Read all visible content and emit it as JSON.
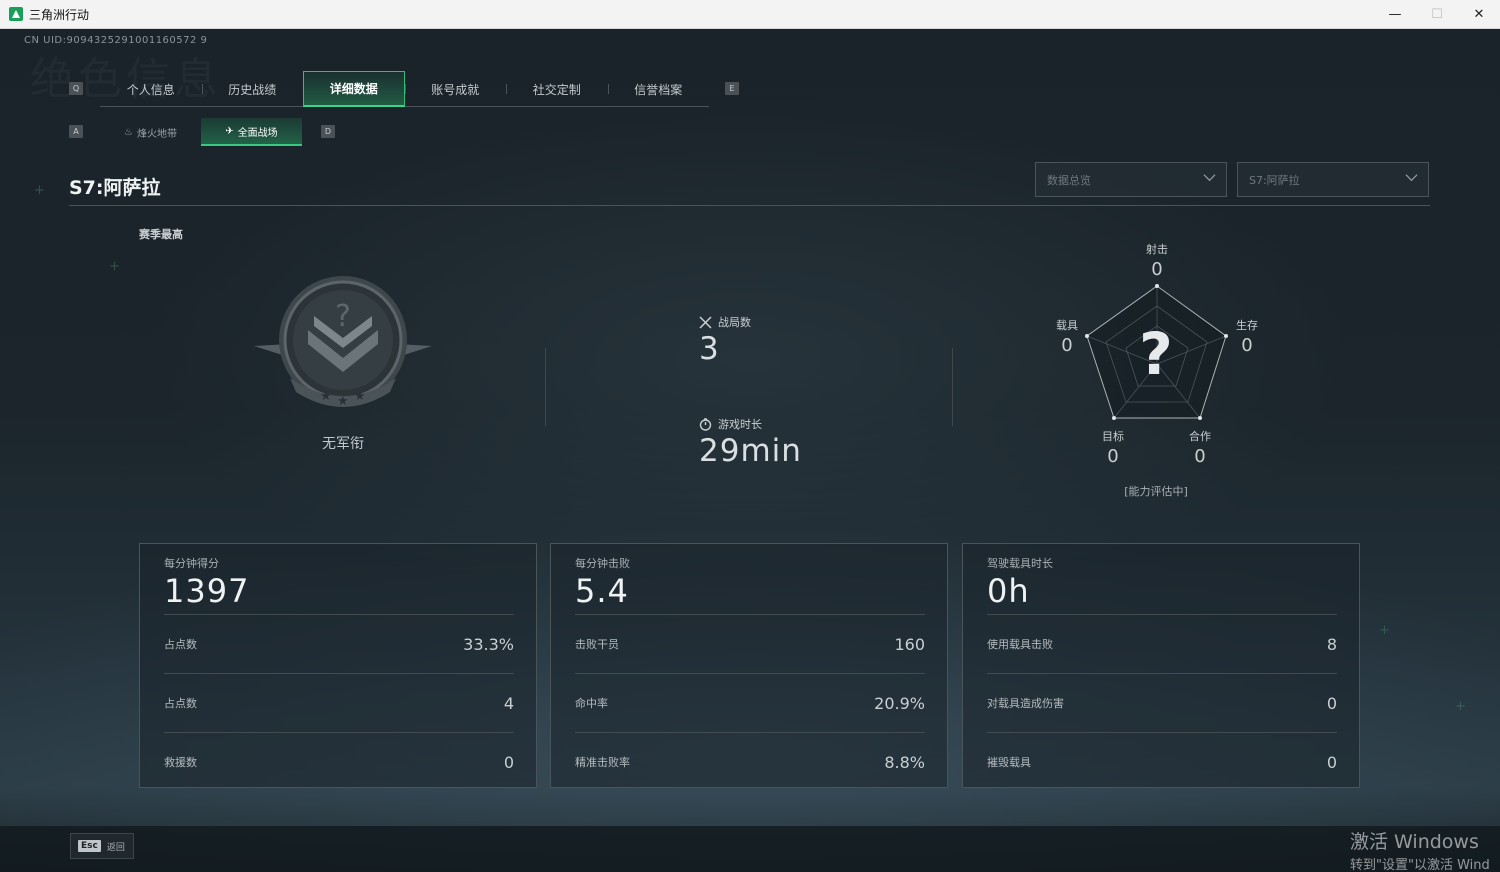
{
  "window": {
    "title": "三角洲行动",
    "controls": {
      "minimize": "—",
      "maximize": "☐",
      "close": "✕"
    }
  },
  "uid": "CN UID:9094325291001160572 9",
  "background_text": "绝色信息",
  "tabs": {
    "left_key": "Q",
    "right_key": "E",
    "items": [
      {
        "label": "个人信息",
        "active": false
      },
      {
        "label": "历史战绩",
        "active": false
      },
      {
        "label": "详细数据",
        "active": true
      },
      {
        "label": "账号成就",
        "active": false
      },
      {
        "label": "社交定制",
        "active": false
      },
      {
        "label": "信誉档案",
        "active": false
      }
    ]
  },
  "subtabs": {
    "left_key": "A",
    "right_key": "D",
    "items": [
      {
        "label": "烽火地带",
        "icon": "campfire-icon",
        "active": false
      },
      {
        "label": "全面战场",
        "icon": "plane-icon",
        "active": true
      }
    ]
  },
  "season": {
    "title": "S7:阿萨拉",
    "best_label": "赛季最高",
    "rank_name": "无军衔"
  },
  "filters": {
    "data_select": "数据总览",
    "season_select": "S7:阿萨拉"
  },
  "overview": {
    "matches_label": "战局数",
    "matches_value": "3",
    "playtime_label": "游戏时长",
    "playtime_value": "29min"
  },
  "radar": {
    "shooting_label": "射击",
    "shooting_value": "0",
    "survival_label": "生存",
    "survival_value": "0",
    "vehicle_label": "载具",
    "vehicle_value": "0",
    "objective_label": "目标",
    "objective_value": "0",
    "teamwork_label": "合作",
    "teamwork_value": "0",
    "center_mark": "?",
    "note": "[能力评估中]"
  },
  "cards": [
    {
      "title": "每分钟得分",
      "value": "1397",
      "rows": [
        {
          "label": "占点数",
          "value": "33.3%"
        },
        {
          "label": "占点数",
          "value": "4"
        },
        {
          "label": "救援数",
          "value": "0"
        }
      ]
    },
    {
      "title": "每分钟击败",
      "value": "5.4",
      "rows": [
        {
          "label": "击败干员",
          "value": "160"
        },
        {
          "label": "命中率",
          "value": "20.9%"
        },
        {
          "label": "精准击败率",
          "value": "8.8%"
        }
      ]
    },
    {
      "title": "驾驶载具时长",
      "value": "0h",
      "rows": [
        {
          "label": "使用载具击败",
          "value": "8"
        },
        {
          "label": "对载具造成伤害",
          "value": "0"
        },
        {
          "label": "摧毁载具",
          "value": "0"
        }
      ]
    }
  ],
  "footer": {
    "esc_key": "Esc",
    "back_label": "返回"
  },
  "activation": {
    "line1": "激活 Windows",
    "line2": "转到\"设置\"以激活 Wind"
  },
  "colors": {
    "accent": "#2fbf7a",
    "background": "#1b252b",
    "card_border": "#4a5459"
  }
}
